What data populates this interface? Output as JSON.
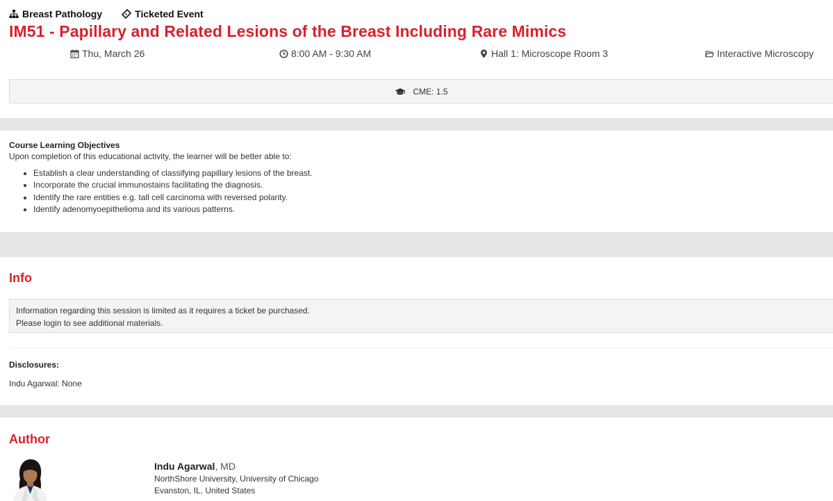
{
  "tags": {
    "track": "Breast Pathology",
    "ticket": "Ticketed Event"
  },
  "session": {
    "title": "IM51 - Papillary and Related Lesions of the Breast Including Rare Mimics",
    "date": "Thu, March 26",
    "time": "8:00 AM - 9:30 AM",
    "location": "Hall 1: Microscope Room 3",
    "category": "Interactive Microscopy",
    "cme": "CME: 1.5"
  },
  "objectives": {
    "title": "Course Learning Objectives",
    "intro": "Upon completion of this educational activity, the learner will be better able to:",
    "items": [
      "Establish a clear understanding of classifying papillary lesions of the breast.",
      "Incorporate the crucial immunostains facilitating the diagnosis.",
      "Identify the rare entities e.g. tall cell carcinoma with reversed polarity.",
      "Identify adenomyoepithelioma and its various patterns."
    ]
  },
  "info": {
    "heading": "Info",
    "line1": "Information regarding this session is limited as it requires a ticket be purchased.",
    "line2": "Please login to see additional materials.",
    "disclosures_label": "Disclosures:",
    "disclosures_text": "Indu Agarwal: None"
  },
  "author": {
    "heading": "Author",
    "name": "Indu Agarwal",
    "credentials": ", MD",
    "affiliation": "NorthShore University, University of Chicago",
    "location": "Evanston, IL, United States"
  },
  "colors": {
    "accent": "#d8212c",
    "panel": "#f4f4f4",
    "page_bg": "#e5e5e5"
  }
}
